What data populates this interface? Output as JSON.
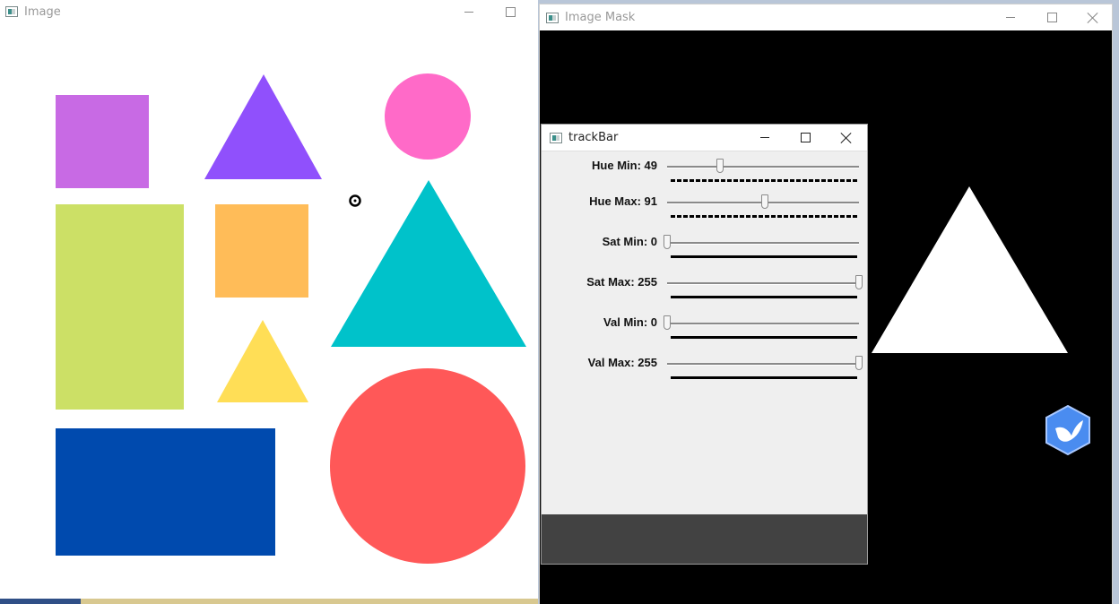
{
  "image_window": {
    "title": "Image",
    "shapes": [
      {
        "name": "purple-square",
        "color": "#c86ae4"
      },
      {
        "name": "violet-triangle",
        "color": "#9050fc"
      },
      {
        "name": "pink-circle",
        "color": "#ff6ac8"
      },
      {
        "name": "lime-rectangle",
        "color": "#cce066"
      },
      {
        "name": "orange-square",
        "color": "#ffbc58"
      },
      {
        "name": "cyan-triangle",
        "color": "#00c2ca"
      },
      {
        "name": "yellow-triangle",
        "color": "#ffde56"
      },
      {
        "name": "blue-rectangle",
        "color": "#004aae"
      },
      {
        "name": "red-circle",
        "color": "#ff5858"
      }
    ]
  },
  "mask_window": {
    "title": "Image Mask"
  },
  "trackbar_window": {
    "title": "trackBar",
    "trackbars": [
      {
        "label": "Hue Min: 49",
        "value": 49,
        "max": 179,
        "underline": "dashed"
      },
      {
        "label": "Hue Max: 91",
        "value": 91,
        "max": 179,
        "underline": "dashed"
      },
      {
        "label": "Sat Min: 0",
        "value": 0,
        "max": 255,
        "underline": "solid"
      },
      {
        "label": "Sat Max: 255",
        "value": 255,
        "max": 255,
        "underline": "solid"
      },
      {
        "label": "Val Min: 0",
        "value": 0,
        "max": 255,
        "underline": "solid"
      },
      {
        "label": "Val Max: 255",
        "value": 255,
        "max": 255,
        "underline": "solid"
      }
    ]
  },
  "colors": {
    "mask_bg": "#000000",
    "mask_shape": "#ffffff",
    "trackbar_bg": "#efefef",
    "trackbar_footer": "#424242",
    "app_badge": "#4a8cf0"
  }
}
